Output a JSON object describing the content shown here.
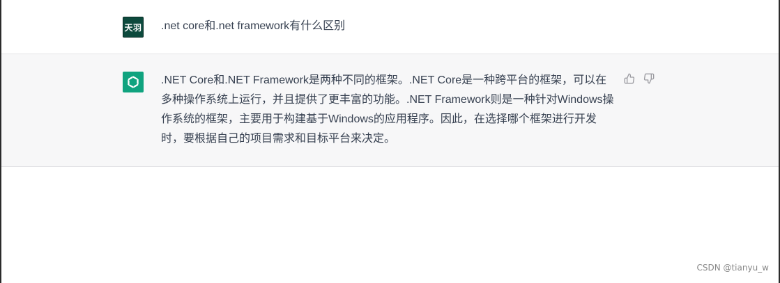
{
  "conversation": {
    "user": {
      "avatar_text": "天羽",
      "message": ".net core和.net framework有什么区别"
    },
    "assistant": {
      "avatar_icon": "openai-logo-icon",
      "message": ".NET Core和.NET Framework是两种不同的框架。.NET Core是一种跨平台的框架，可以在多种操作系统上运行，并且提供了更丰富的功能。.NET Framework则是一种针对Windows操作系统的框架，主要用于构建基于Windows的应用程序。因此，在选择哪个框架进行开发时，要根据自己的项目需求和目标平台来决定。",
      "feedback_icons": [
        "thumbs-up-icon",
        "thumbs-down-icon"
      ]
    }
  },
  "watermark": "CSDN @tianyu_w",
  "colors": {
    "user_avatar_bg": "#0d4a3d",
    "assistant_avatar_bg": "#10a37f",
    "assistant_row_bg": "#f7f7f8",
    "text": "#374151"
  }
}
